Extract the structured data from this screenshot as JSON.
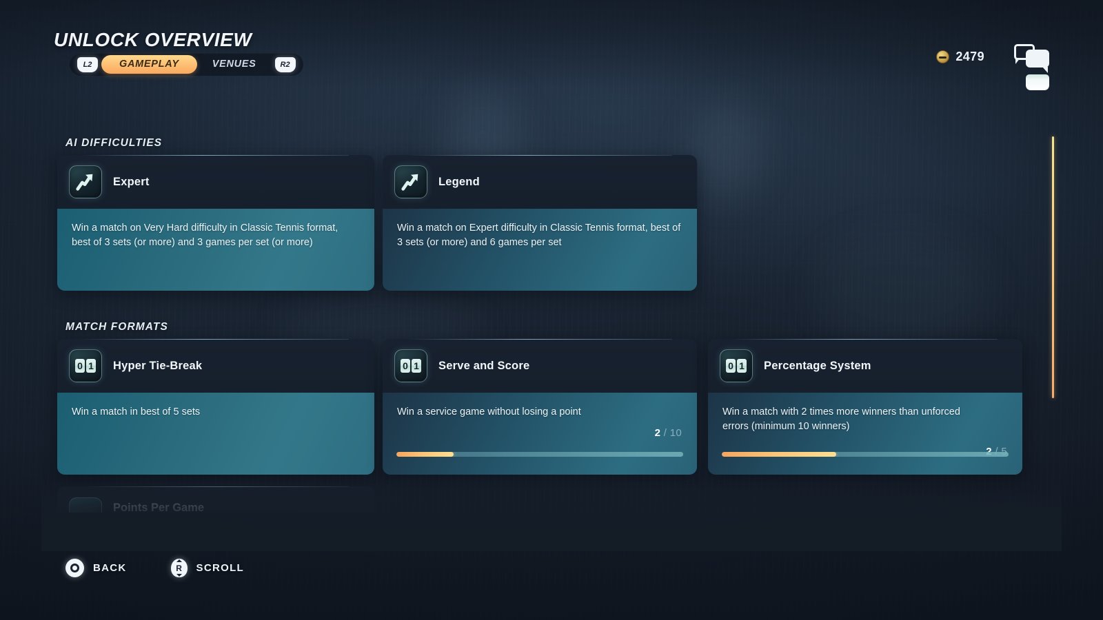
{
  "header": {
    "title": "UNLOCK OVERVIEW",
    "left_shoulder": "L2",
    "right_shoulder": "R2",
    "tabs": [
      {
        "label": "GAMEPLAY",
        "active": true
      },
      {
        "label": "VENUES",
        "active": false
      }
    ]
  },
  "currency": {
    "icon": "coin-icon",
    "value": "2479"
  },
  "chat": {
    "icon": "chat-bubbles-icon"
  },
  "sections": [
    {
      "title": "AI DIFFICULTIES",
      "cards": [
        {
          "icon": "trending-up-arrow-icon",
          "title": "Expert",
          "description": "Win a match on Very Hard difficulty in Classic Tennis format, best of 3 sets (or more) and 3 games per set (or more)",
          "progress": null
        },
        {
          "icon": "trending-up-arrow-icon",
          "title": "Legend",
          "description": "Win a match on Expert difficulty in Classic Tennis format, best of 3 sets (or more) and 6 games per set",
          "progress": null
        }
      ]
    },
    {
      "title": "MATCH FORMATS",
      "cards": [
        {
          "icon": "scoreboard-01-icon",
          "title": "Hyper Tie-Break",
          "description": "Win a match in best of 5 sets",
          "progress": null
        },
        {
          "icon": "scoreboard-01-icon",
          "title": "Serve and Score",
          "description": "Win a service game without losing a point",
          "progress": {
            "current": "2",
            "separator": "/",
            "total": "10",
            "percent": 20
          }
        },
        {
          "icon": "scoreboard-01-icon",
          "title": "Percentage System",
          "description": "Win a match with 2 times more winners than unforced errors (minimum 10 winners)",
          "progress": {
            "current": "2",
            "separator": "/",
            "total": "5",
            "percent": 40
          }
        }
      ]
    }
  ],
  "clipped_card": {
    "icon": "scoreboard-01-icon",
    "title": "Points Per Game"
  },
  "scoreboard_icon": {
    "left_digit": "0",
    "right_digit": "1"
  },
  "footer": {
    "hints": [
      {
        "button": "circle-button-icon",
        "label": "BACK"
      },
      {
        "button": "right-stick-icon",
        "label": "SCROLL"
      }
    ]
  },
  "colors": {
    "accent_orange": "#f9a95f",
    "accent_yellow": "#ffd98c",
    "card_body_teal": "#2f6e82",
    "card_head_navy": "#18212f",
    "background": "#16202e"
  }
}
